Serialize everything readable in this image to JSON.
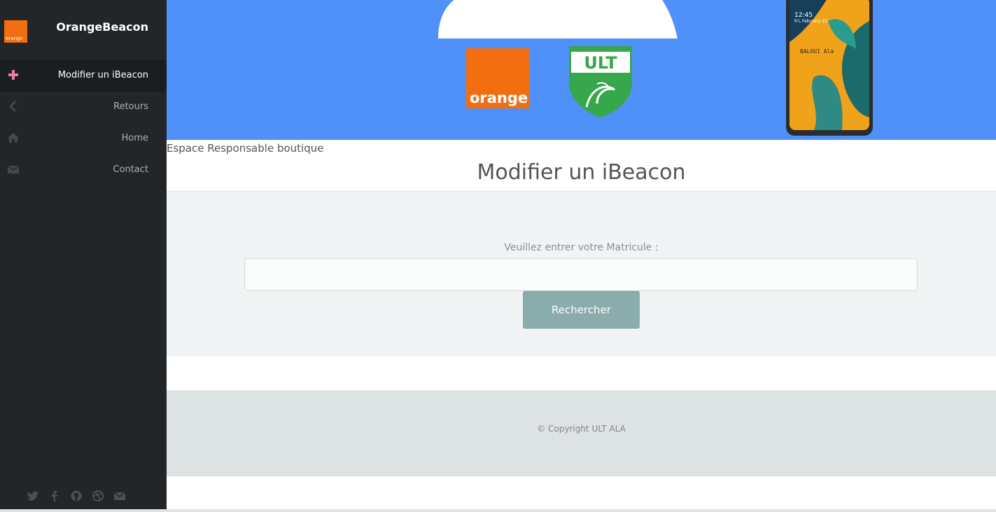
{
  "sidebar": {
    "brand": {
      "logo_text": "orange",
      "name": "OrangeBeacon"
    },
    "items": [
      {
        "label": "Modifier un iBeacon",
        "icon": "plus-icon"
      },
      {
        "label": "Retours",
        "icon": "chevron-left-icon"
      },
      {
        "label": "Home",
        "icon": "home-icon"
      },
      {
        "label": "Contact",
        "icon": "envelope-icon"
      }
    ],
    "social": [
      "twitter-icon",
      "facebook-icon",
      "github-icon",
      "dribbble-icon",
      "envelope-icon"
    ]
  },
  "header": {
    "orange_logo_text": "orange",
    "ult_logo_text": "ULT",
    "phone": {
      "time": "12:45",
      "date": "Fri, February 22",
      "owner": "BALOUI Ala"
    }
  },
  "page": {
    "subtitle": "Espace Responsable boutique",
    "title": "Modifier un iBeacon"
  },
  "form": {
    "label": "Veuillez entrer votre Matricule :",
    "input_value": "",
    "button_label": "Rechercher"
  },
  "footer": {
    "copyright": "© Copyright ULT ALA"
  },
  "colors": {
    "sidebar_bg": "#222629",
    "header_bg": "#4f91f9",
    "orange": "#f26e10",
    "button": "#8bacac",
    "plus_icon": "#e87ea8"
  }
}
